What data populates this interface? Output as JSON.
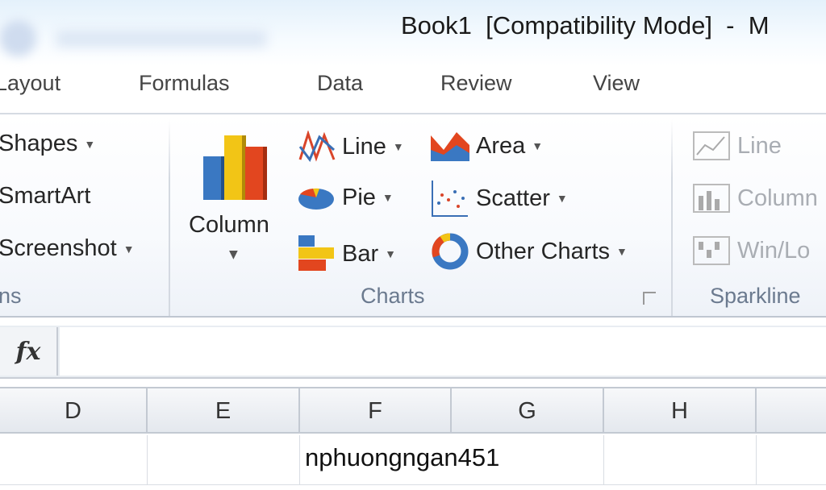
{
  "titlebar": {
    "title": "Book1  [Compatibility Mode]  -  M"
  },
  "tabs": [
    "Layout",
    "Formulas",
    "Data",
    "Review",
    "View"
  ],
  "illustrations": {
    "items": [
      "Shapes",
      "SmartArt",
      "Screenshot"
    ],
    "group_label": "ns"
  },
  "charts": {
    "column": "Column",
    "line": "Line",
    "pie": "Pie",
    "bar": "Bar",
    "area": "Area",
    "scatter": "Scatter",
    "other": "Other Charts",
    "group_label": "Charts"
  },
  "sparklines": {
    "items": [
      "Line",
      "Column",
      "Win/Lo"
    ],
    "group_label": "Sparkline"
  },
  "formula_bar": {
    "fx": "fx",
    "value": ""
  },
  "columns": [
    "D",
    "E",
    "F",
    "G",
    "H"
  ],
  "cells": {
    "F1": "nphuongngan451"
  }
}
